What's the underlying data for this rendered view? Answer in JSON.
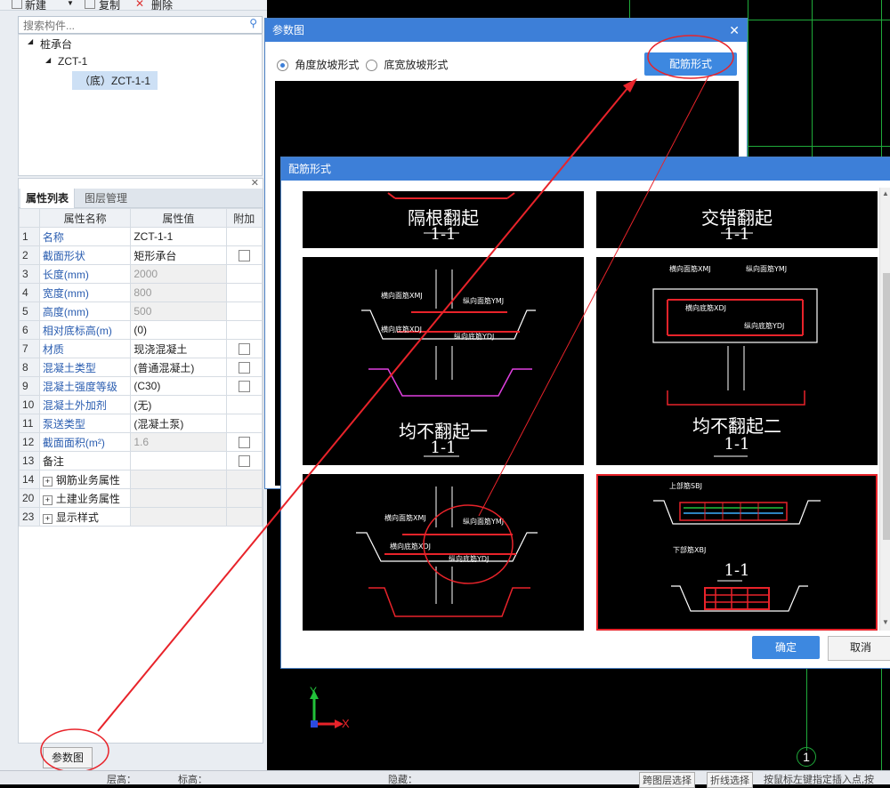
{
  "toolbar": {
    "new_label": "新建",
    "copy_label": "复制",
    "delete_label": "删除"
  },
  "search": {
    "placeholder": "搜索构件..."
  },
  "tree": {
    "root": "桩承台",
    "child": "ZCT-1",
    "leaf": "（底）ZCT-1-1"
  },
  "props": {
    "tab_props": "属性列表",
    "tab_layers": "图层管理",
    "headers": {
      "name": "属性名称",
      "value": "属性值",
      "add": "附加"
    },
    "rows": [
      {
        "num": "1",
        "name": "名称",
        "value": "ZCT-1-1"
      },
      {
        "num": "2",
        "name": "截面形状",
        "value": "矩形承台"
      },
      {
        "num": "3",
        "name": "长度(mm)",
        "value": "2000"
      },
      {
        "num": "4",
        "name": "宽度(mm)",
        "value": "800"
      },
      {
        "num": "5",
        "name": "高度(mm)",
        "value": "500"
      },
      {
        "num": "6",
        "name": "相对底标高(m)",
        "value": "(0)"
      },
      {
        "num": "7",
        "name": "材质",
        "value": "现浇混凝土"
      },
      {
        "num": "8",
        "name": "混凝土类型",
        "value": "(普通混凝土)"
      },
      {
        "num": "9",
        "name": "混凝土强度等级",
        "value": "(C30)"
      },
      {
        "num": "10",
        "name": "混凝土外加剂",
        "value": "(无)"
      },
      {
        "num": "11",
        "name": "泵送类型",
        "value": "(混凝土泵)"
      },
      {
        "num": "12",
        "name": "截面面积(m²)",
        "value": "1.6"
      },
      {
        "num": "13",
        "name": "备注",
        "value": ""
      },
      {
        "num": "14",
        "name": "钢筋业务属性",
        "value": ""
      },
      {
        "num": "20",
        "name": "土建业务属性",
        "value": ""
      },
      {
        "num": "23",
        "name": "显示样式",
        "value": ""
      }
    ]
  },
  "param_button": "参数图",
  "dialog1": {
    "title": "参数图",
    "radio1": "角度放坡形式",
    "radio2": "底宽放坡形式",
    "rebar_button": "配筋形式"
  },
  "dialog2": {
    "title": "配筋形式",
    "options": [
      {
        "label": "隔根翻起",
        "section": "1-1"
      },
      {
        "label": "交错翻起",
        "section": "1-1"
      },
      {
        "label": "均不翻起一",
        "section": "1-1"
      },
      {
        "label": "均不翻起二",
        "section": "1-1"
      },
      {
        "label": "",
        "section": ""
      },
      {
        "label": "",
        "section": "1-1"
      }
    ],
    "ok": "确定",
    "cancel": "取消"
  },
  "cad": {
    "axis_x": "X",
    "axis_y": "Y",
    "grid_marker": "1"
  },
  "status": {
    "floor_label": "层高：",
    "elev_label": "标高：",
    "hidden_label": "隐藏：",
    "cross_layer": "跨图层选择",
    "polyline": "折线选择",
    "hint": "按鼠标左键指定插入点,按"
  },
  "colors": {
    "accent": "#3d7fd8",
    "annotation": "#e8232a",
    "grid": "#1faa3a"
  }
}
